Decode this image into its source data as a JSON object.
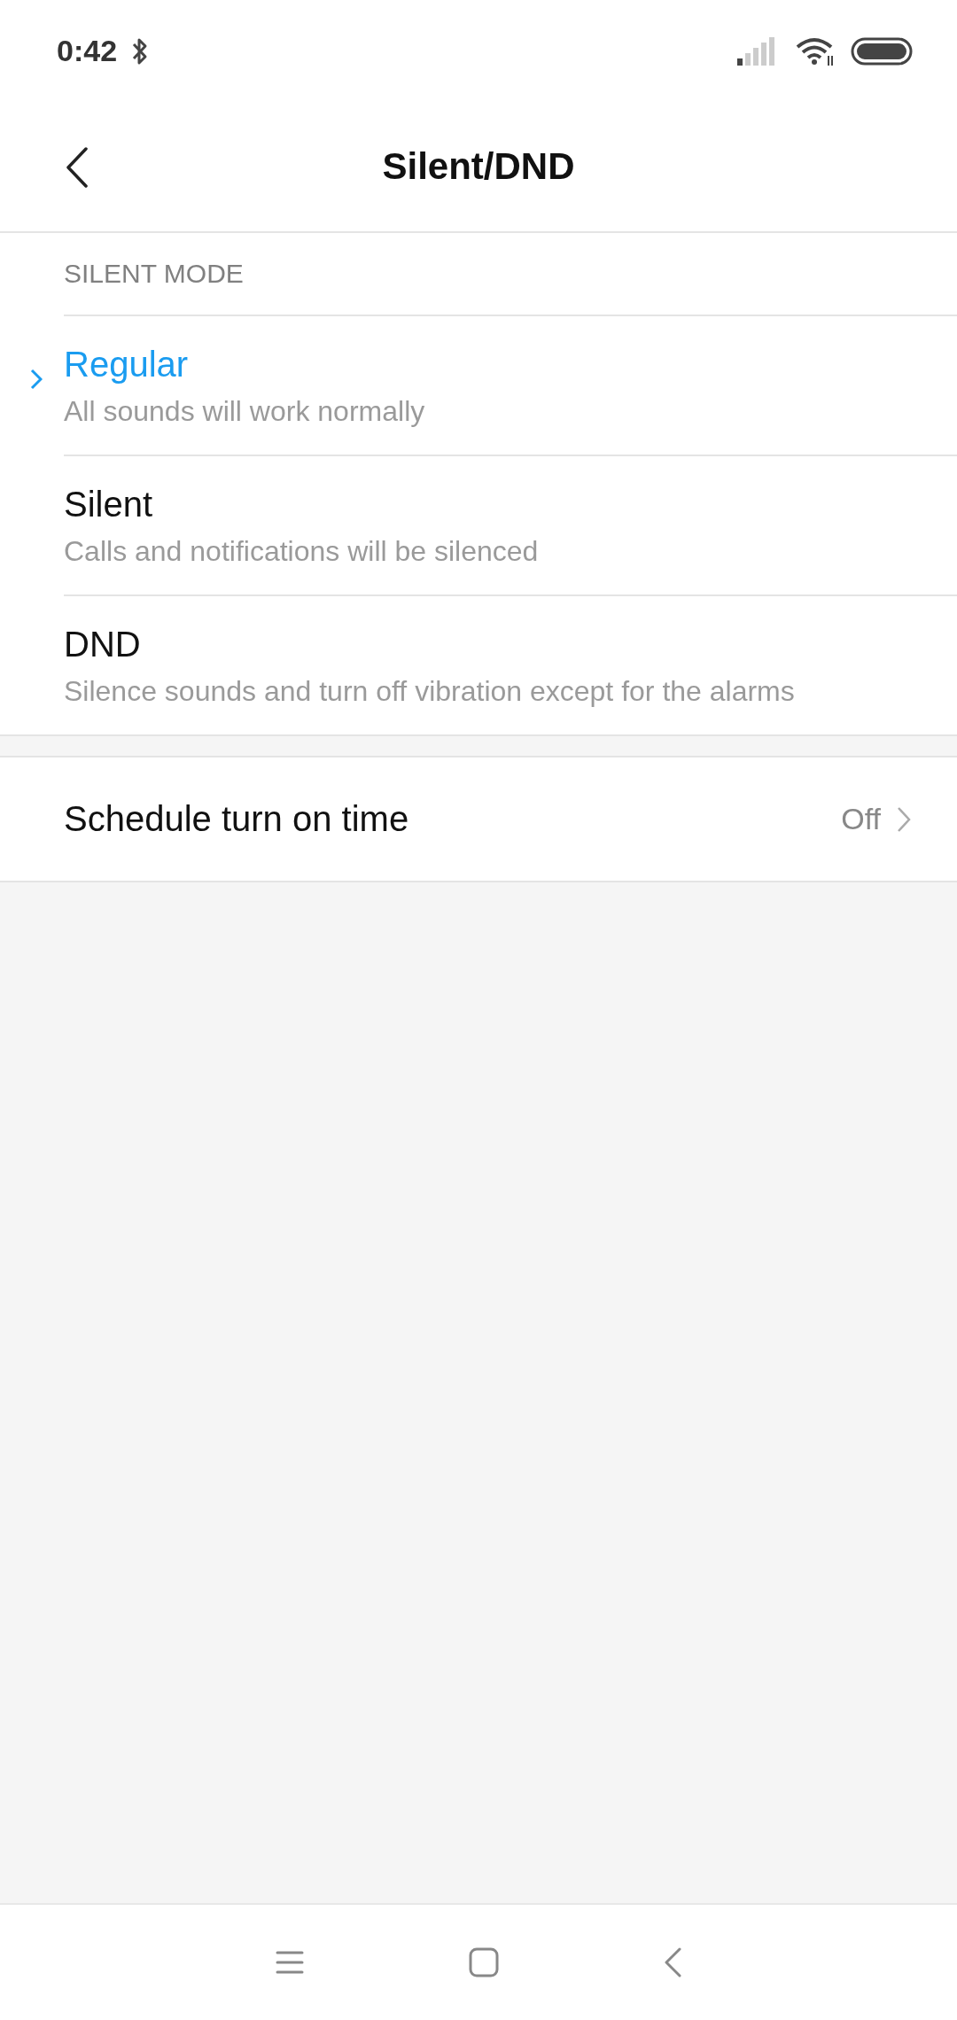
{
  "status_bar": {
    "time": "0:42"
  },
  "header": {
    "title": "Silent/DND"
  },
  "section": {
    "title": "SILENT MODE"
  },
  "modes": [
    {
      "title": "Regular",
      "subtitle": "All sounds will work normally",
      "selected": true
    },
    {
      "title": "Silent",
      "subtitle": "Calls and notifications will be silenced",
      "selected": false
    },
    {
      "title": "DND",
      "subtitle": "Silence sounds and turn off vibration except for the alarms",
      "selected": false
    }
  ],
  "schedule": {
    "label": "Schedule turn on time",
    "value": "Off"
  }
}
